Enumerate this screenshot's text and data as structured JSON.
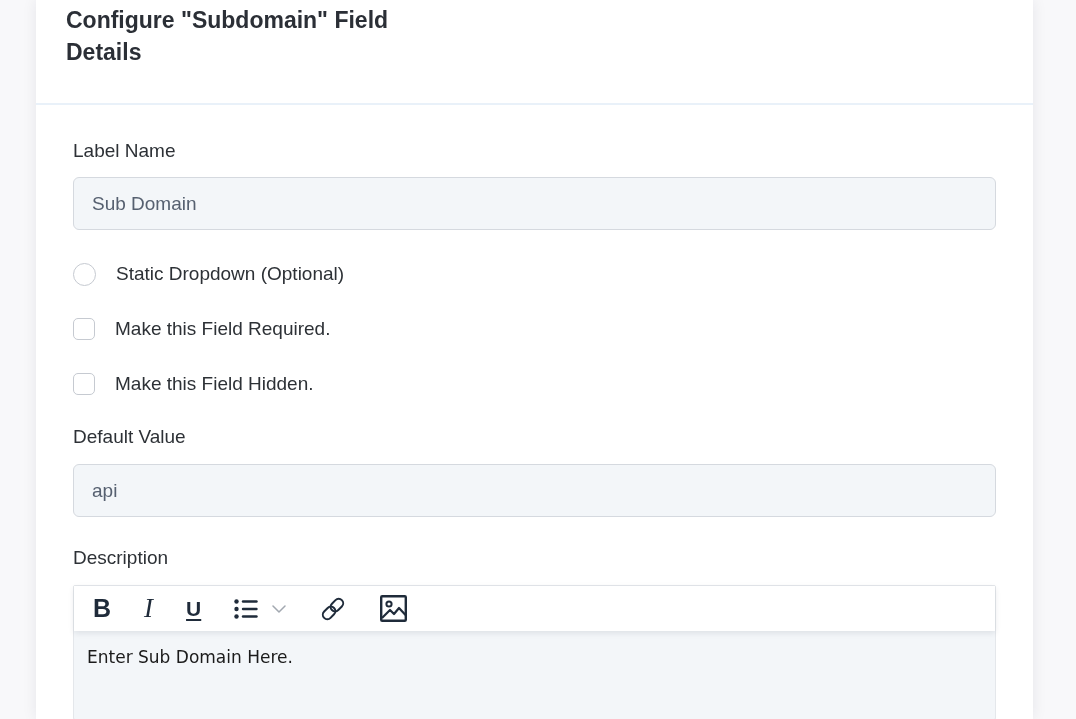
{
  "dialog": {
    "title": "Configure \"Subdomain\" Field Details"
  },
  "form": {
    "label_name": {
      "label": "Label Name",
      "value": "Sub Domain"
    },
    "options": [
      {
        "kind": "radio",
        "label": "Static Dropdown (Optional)",
        "checked": false
      },
      {
        "kind": "checkbox",
        "label": "Make this Field Required.",
        "checked": false
      },
      {
        "kind": "checkbox",
        "label": "Make this Field Hidden.",
        "checked": false
      }
    ],
    "default_value": {
      "label": "Default Value",
      "value": "api"
    },
    "description": {
      "label": "Description",
      "toolbar": [
        {
          "kind": "bold",
          "label": "B"
        },
        {
          "kind": "italic",
          "label": "I"
        },
        {
          "kind": "underline",
          "label": "U"
        },
        {
          "kind": "list"
        },
        {
          "kind": "link"
        },
        {
          "kind": "image"
        }
      ],
      "value": "Enter Sub Domain Here."
    }
  }
}
